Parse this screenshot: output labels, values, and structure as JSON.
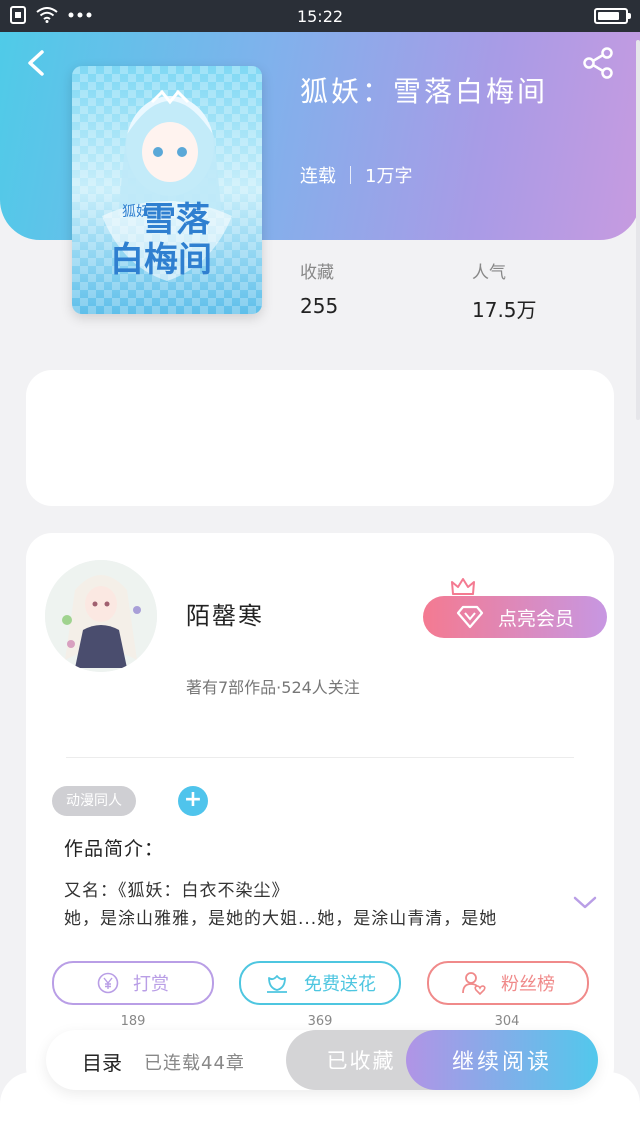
{
  "status_bar": {
    "time": "15:22",
    "battery_level": 0.8
  },
  "book": {
    "title": "狐妖：雪落白梅间",
    "status": "连载",
    "word_count": "1万字",
    "stats": [
      {
        "label": "收藏",
        "value": "255"
      },
      {
        "label": "人气",
        "value": "17.5万"
      }
    ]
  },
  "author": {
    "name": "陌罄寒",
    "stats": "著有7部作品·524人关注",
    "vip_label": "点亮会员"
  },
  "tags": [
    "动漫同人"
  ],
  "add_tag_label": "+",
  "intro": {
    "title": "作品简介：",
    "lines": [
      "又名：《狐妖：白衣不染尘》",
      "她，是涂山雅雅，是她的大姐...她，是涂山青清，是她"
    ]
  },
  "actions": [
    {
      "label": "打赏",
      "count": "189",
      "color": "#b99ee6",
      "icon": "yen-icon"
    },
    {
      "label": "免费送花",
      "count": "369",
      "color": "#4ec6e0",
      "icon": "flower-icon"
    },
    {
      "label": "粉丝榜",
      "count": "304",
      "color": "#f08a8a",
      "icon": "fans-icon"
    }
  ],
  "bottom": {
    "toc_label": "目录",
    "chapter_count": "已连载44章",
    "collected_label": "已收藏",
    "read_label": "继续阅读"
  },
  "colors": {
    "header_gradient": [
      "#4fcbe8",
      "#c79be0"
    ],
    "vip_gradient": [
      "#f47a91",
      "#c797e2"
    ],
    "read_gradient": [
      "#b194e6",
      "#52c8ec"
    ]
  }
}
